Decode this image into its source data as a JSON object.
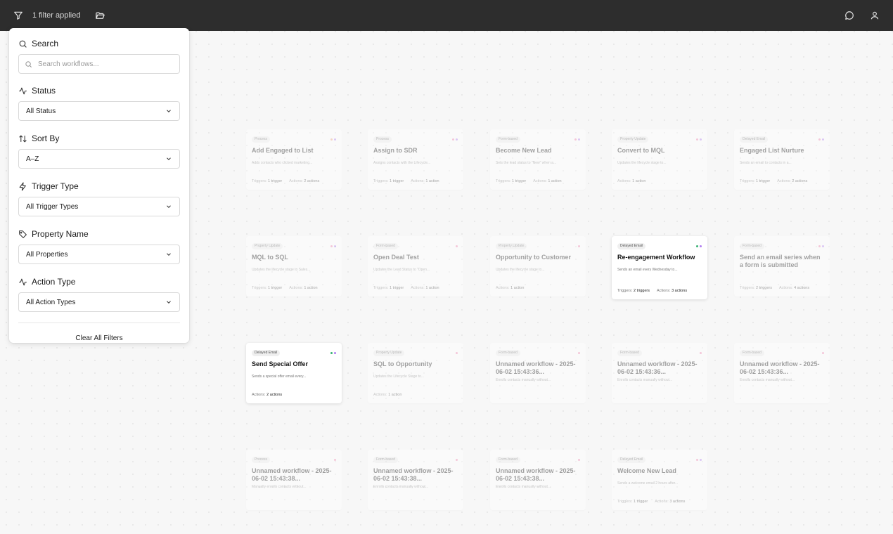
{
  "topbar": {
    "filter_status": "1 filter applied",
    "icons": [
      "filter-icon",
      "folder-open-icon",
      "chat-icon",
      "user-icon"
    ]
  },
  "filters": {
    "search": {
      "label": "Search",
      "placeholder": "Search workflows...",
      "value": ""
    },
    "status": {
      "label": "Status",
      "value": "All Status"
    },
    "sort_by": {
      "label": "Sort By",
      "value": "A–Z"
    },
    "trigger_type": {
      "label": "Trigger Type",
      "value": "All Trigger Types"
    },
    "property_name": {
      "label": "Property Name",
      "value": "All Properties"
    },
    "action_type": {
      "label": "Action Type",
      "value": "All Action Types"
    },
    "clear_label": "Clear All Filters"
  },
  "colors": {
    "topbar": "#2d2d2d",
    "dot_pink": "#f07ca9",
    "dot_purple": "#b07cf0",
    "dot_green": "#3bb273",
    "dot_orange": "#f0a07c"
  },
  "workflows": [
    {
      "badge": "Process",
      "title": "Add Engaged to List",
      "desc": "Adds contacts who clicked marketing...",
      "triggers": "1 trigger",
      "actions": "2 actions",
      "active": false,
      "dots": [
        "dot_orange",
        "dot_purple"
      ]
    },
    {
      "badge": "Process",
      "title": "Assign to SDR",
      "desc": "Assigns contacts with the Lifecycle...",
      "triggers": "1 trigger",
      "actions": "1 action",
      "active": false,
      "dots": [
        "dot_pink",
        "dot_purple"
      ]
    },
    {
      "badge": "Form-based",
      "title": "Become New Lead",
      "desc": "Sets the lead status to \"New\" when a...",
      "triggers": "1 trigger",
      "actions": "1 action",
      "active": false,
      "dots": [
        "dot_pink",
        "dot_purple"
      ]
    },
    {
      "badge": "Property Update",
      "title": "Convert to MQL",
      "desc": "Updates the lifecycle stage to...",
      "triggers": "",
      "actions": "1 action",
      "active": false,
      "dots": [
        "dot_pink",
        "dot_purple"
      ]
    },
    {
      "badge": "Delayed Email",
      "title": "Engaged List Nurture",
      "desc": "Sends an email to contacts in a...",
      "triggers": "1 trigger",
      "actions": "2 actions",
      "active": false,
      "dots": [
        "dot_pink",
        "dot_purple"
      ]
    },
    {
      "badge": "Property Update",
      "title": "MQL to SQL",
      "desc": "Updates the lifecycle stage to Sales...",
      "triggers": "1 trigger",
      "actions": "1 action",
      "active": false,
      "dots": [
        "dot_pink",
        "dot_purple"
      ]
    },
    {
      "badge": "Form-based",
      "title": "Open Deal Test",
      "desc": "Updates the Lead Status to \"Open...",
      "triggers": "1 trigger",
      "actions": "1 action",
      "active": false,
      "dots": [
        "dot_pink"
      ]
    },
    {
      "badge": "Property Update",
      "title": "Opportunity to Customer",
      "desc": "Updates the lifecycle stage to...",
      "triggers": "",
      "actions": "1 action",
      "active": false,
      "dots": [
        "dot_pink"
      ]
    },
    {
      "badge": "Delayed Email",
      "title": "Re-engagement Workflow",
      "desc": "Sends an email every Wednesday to...",
      "triggers": "2 triggers",
      "actions": "3 actions",
      "active": true,
      "dots": [
        "dot_green",
        "dot_purple"
      ]
    },
    {
      "badge": "Form-based",
      "title": "Send an email series when a form is submitted",
      "desc": "",
      "triggers": "2 triggers",
      "actions": "4 actions",
      "active": false,
      "dots": [
        "dot_pink",
        "dot_purple"
      ]
    },
    {
      "badge": "Delayed Email",
      "title": "Send Special Offer",
      "desc": "Sends a special offer email every...",
      "triggers": "",
      "actions": "2 actions",
      "active": true,
      "dots": [
        "dot_green",
        "dot_purple"
      ]
    },
    {
      "badge": "Property Update",
      "title": "SQL to Opportunity",
      "desc": "Updates the Lifecycle Stage to...",
      "triggers": "",
      "actions": "1 action",
      "active": false,
      "dots": [
        "dot_pink"
      ]
    },
    {
      "badge": "Form-based",
      "title": "Unnamed workflow - 2025-06-02 15:43:36...",
      "desc": "Enrolls contacts manually without...",
      "triggers": "",
      "actions": "",
      "active": false,
      "dots": [
        "dot_pink"
      ]
    },
    {
      "badge": "Form-based",
      "title": "Unnamed workflow - 2025-06-02 15:43:36...",
      "desc": "Enrolls contacts manually without...",
      "triggers": "",
      "actions": "",
      "active": false,
      "dots": [
        "dot_pink"
      ]
    },
    {
      "badge": "Form-based",
      "title": "Unnamed workflow - 2025-06-02 15:43:36...",
      "desc": "Enrolls contacts manually without...",
      "triggers": "",
      "actions": "",
      "active": false,
      "dots": [
        "dot_pink"
      ]
    },
    {
      "badge": "Process",
      "title": "Unnamed workflow - 2025-06-02 15:43:38...",
      "desc": "Manually enrolls contacts without...",
      "triggers": "",
      "actions": "",
      "active": false,
      "dots": [
        "dot_pink"
      ]
    },
    {
      "badge": "Form-based",
      "title": "Unnamed workflow - 2025-06-02 15:43:38...",
      "desc": "Enrolls contacts manually without...",
      "triggers": "",
      "actions": "",
      "active": false,
      "dots": [
        "dot_pink"
      ]
    },
    {
      "badge": "Form-based",
      "title": "Unnamed workflow - 2025-06-02 15:43:38...",
      "desc": "Enrolls contacts manually without...",
      "triggers": "",
      "actions": "",
      "active": false,
      "dots": [
        "dot_pink"
      ]
    },
    {
      "badge": "Delayed Email",
      "title": "Welcome New Lead",
      "desc": "Sends a welcome email 2 hours after...",
      "triggers": "1 trigger",
      "actions": "3 actions",
      "active": false,
      "dots": [
        "dot_pink",
        "dot_purple"
      ]
    }
  ],
  "labels": {
    "triggers": "Triggers:",
    "actions": "Actions:"
  }
}
